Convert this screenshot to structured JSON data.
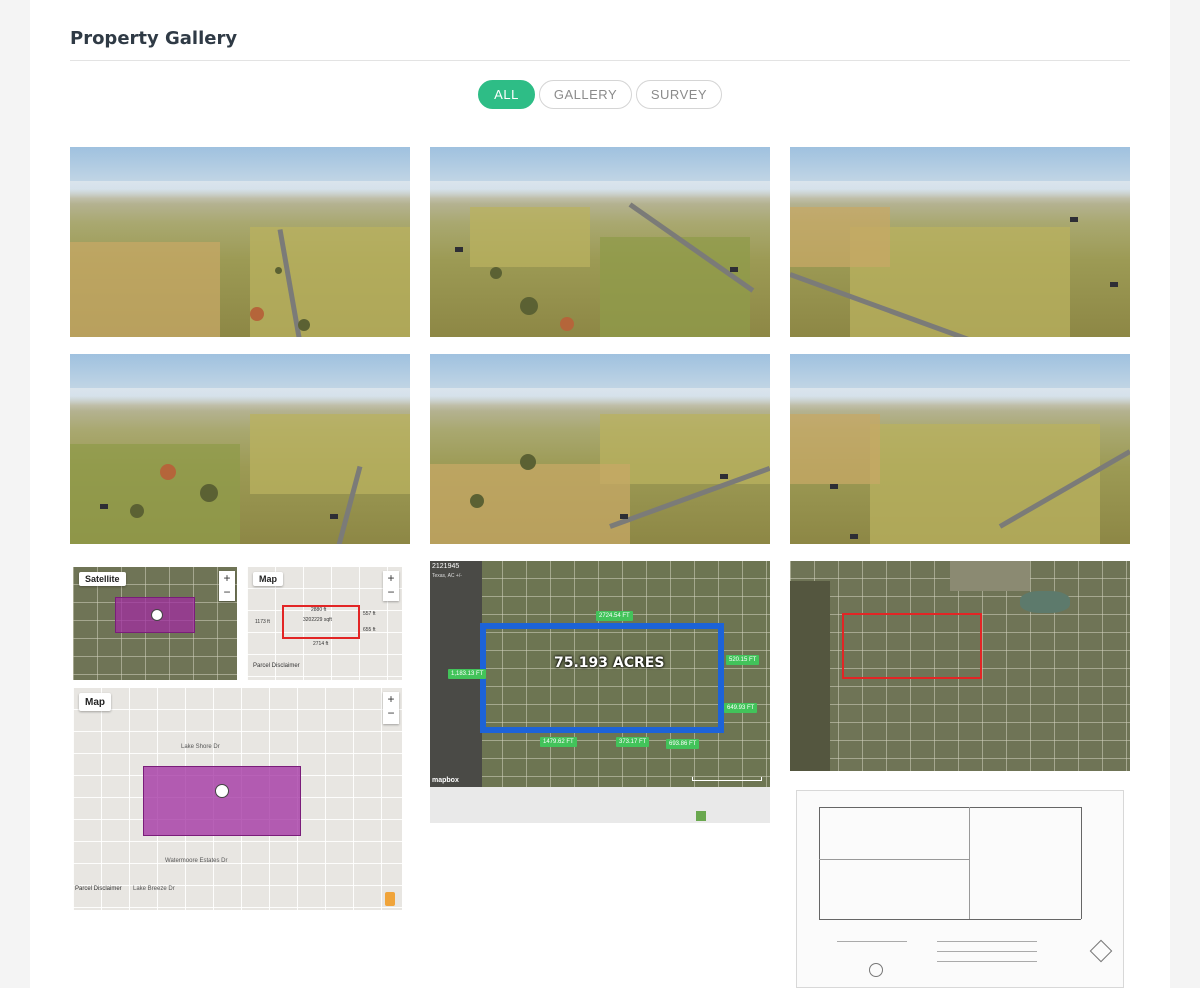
{
  "gallery": {
    "title": "Property Gallery",
    "filters": [
      {
        "label": "ALL",
        "active": true
      },
      {
        "label": "GALLERY",
        "active": false
      },
      {
        "label": "SURVEY",
        "active": false
      }
    ]
  },
  "maps": {
    "sat_map_type": "Satellite",
    "road_map_type": "Map",
    "road_map_type_large": "Map",
    "area_sqft": "3202229 sqft",
    "edge_top": "2880 ft",
    "edge_left": "1173 ft",
    "edge_right": "557 ft",
    "edge_bottom": "2714 ft",
    "edge_right_low": "655 ft",
    "parcel_disclaimer": "Parcel Disclaimer",
    "parcel_disclaimer_large": "Parcel Disclaimer",
    "listing_id": "2121945",
    "location": "Texas, AC +/-",
    "acres_label": "75.193 ACRES",
    "mapbox_label": "mapbox",
    "dims": [
      "2724.54 FT",
      "1,183.13 FT",
      "520.15 FT",
      "649.93 FT",
      "1479.62 FT",
      "373.17 FT",
      "693.86 FT"
    ],
    "street_lake_shore": "Lake Shore Dr",
    "street_watermoore": "Watermoore Estates Dr",
    "street_lake_breeze": "Lake Breeze Dr"
  },
  "colors": {
    "accent": "#2ebd86",
    "title": "#2f3a45",
    "parcel_purple": "#a02ca0",
    "boundary_red": "#e22525",
    "boundary_blue": "#1d63d8"
  }
}
